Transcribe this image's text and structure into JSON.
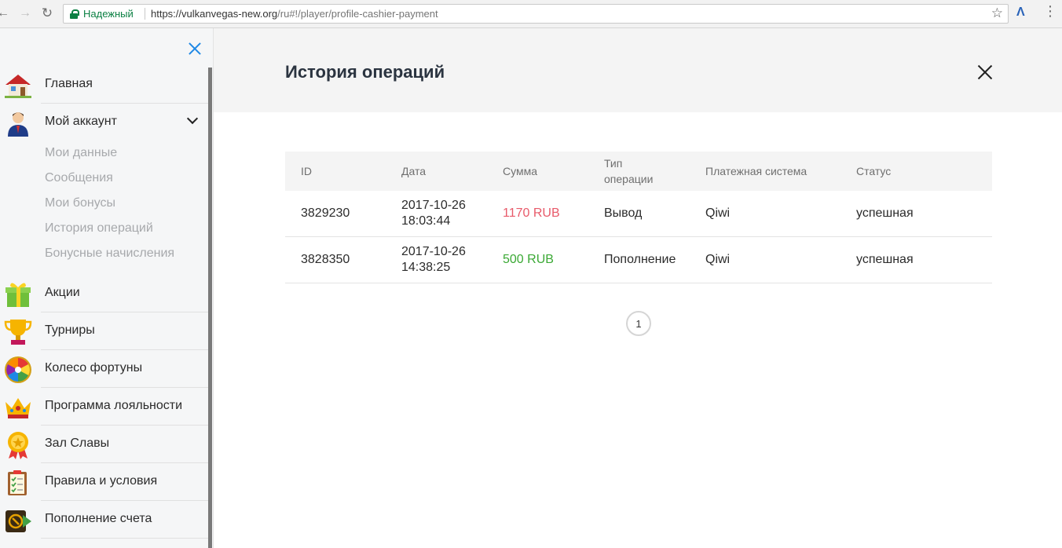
{
  "browser": {
    "secure_label": "Надежный",
    "url_host": "https://vulkanvegas-new.org",
    "url_path": "/ru#!/player/profile-cashier-payment"
  },
  "sidebar": {
    "items": [
      {
        "label": "Главная",
        "icon": "house-icon"
      },
      {
        "label": "Мой аккаунт",
        "icon": "user-icon"
      },
      {
        "label": "Акции",
        "icon": "gift-icon"
      },
      {
        "label": "Турниры",
        "icon": "trophy-icon"
      },
      {
        "label": "Колесо фортуны",
        "icon": "fortune-wheel-icon"
      },
      {
        "label": "Программа лояльности",
        "icon": "crown-icon"
      },
      {
        "label": "Зал Славы",
        "icon": "medal-icon"
      },
      {
        "label": "Правила и условия",
        "icon": "checklist-icon"
      },
      {
        "label": "Пополнение счета",
        "icon": "deposit-icon"
      }
    ],
    "account_submenu": [
      "Мои данные",
      "Сообщения",
      "Мои бонусы",
      "История операций",
      "Бонусные начисления"
    ]
  },
  "main": {
    "title": "История операций",
    "table": {
      "headers": {
        "id": "ID",
        "date": "Дата",
        "amount": "Сумма",
        "type_line1": "Тип",
        "type_line2": "операции",
        "system": "Платежная система",
        "status": "Статус"
      },
      "rows": [
        {
          "id": "3829230",
          "date": "2017-10-26",
          "time": "18:03:44",
          "amount": "1170 RUB",
          "type": "Вывод",
          "system": "Qiwi",
          "status": "успешная"
        },
        {
          "id": "3828350",
          "date": "2017-10-26",
          "time": "14:38:25",
          "amount": "500 RUB",
          "type": "Пополнение",
          "system": "Qiwi",
          "status": "успешная"
        }
      ]
    },
    "pagination": {
      "current": "1"
    }
  },
  "colors": {
    "withdrawal": "#e85a6a",
    "deposit": "#3ba935",
    "accent": "#1e88e5"
  }
}
